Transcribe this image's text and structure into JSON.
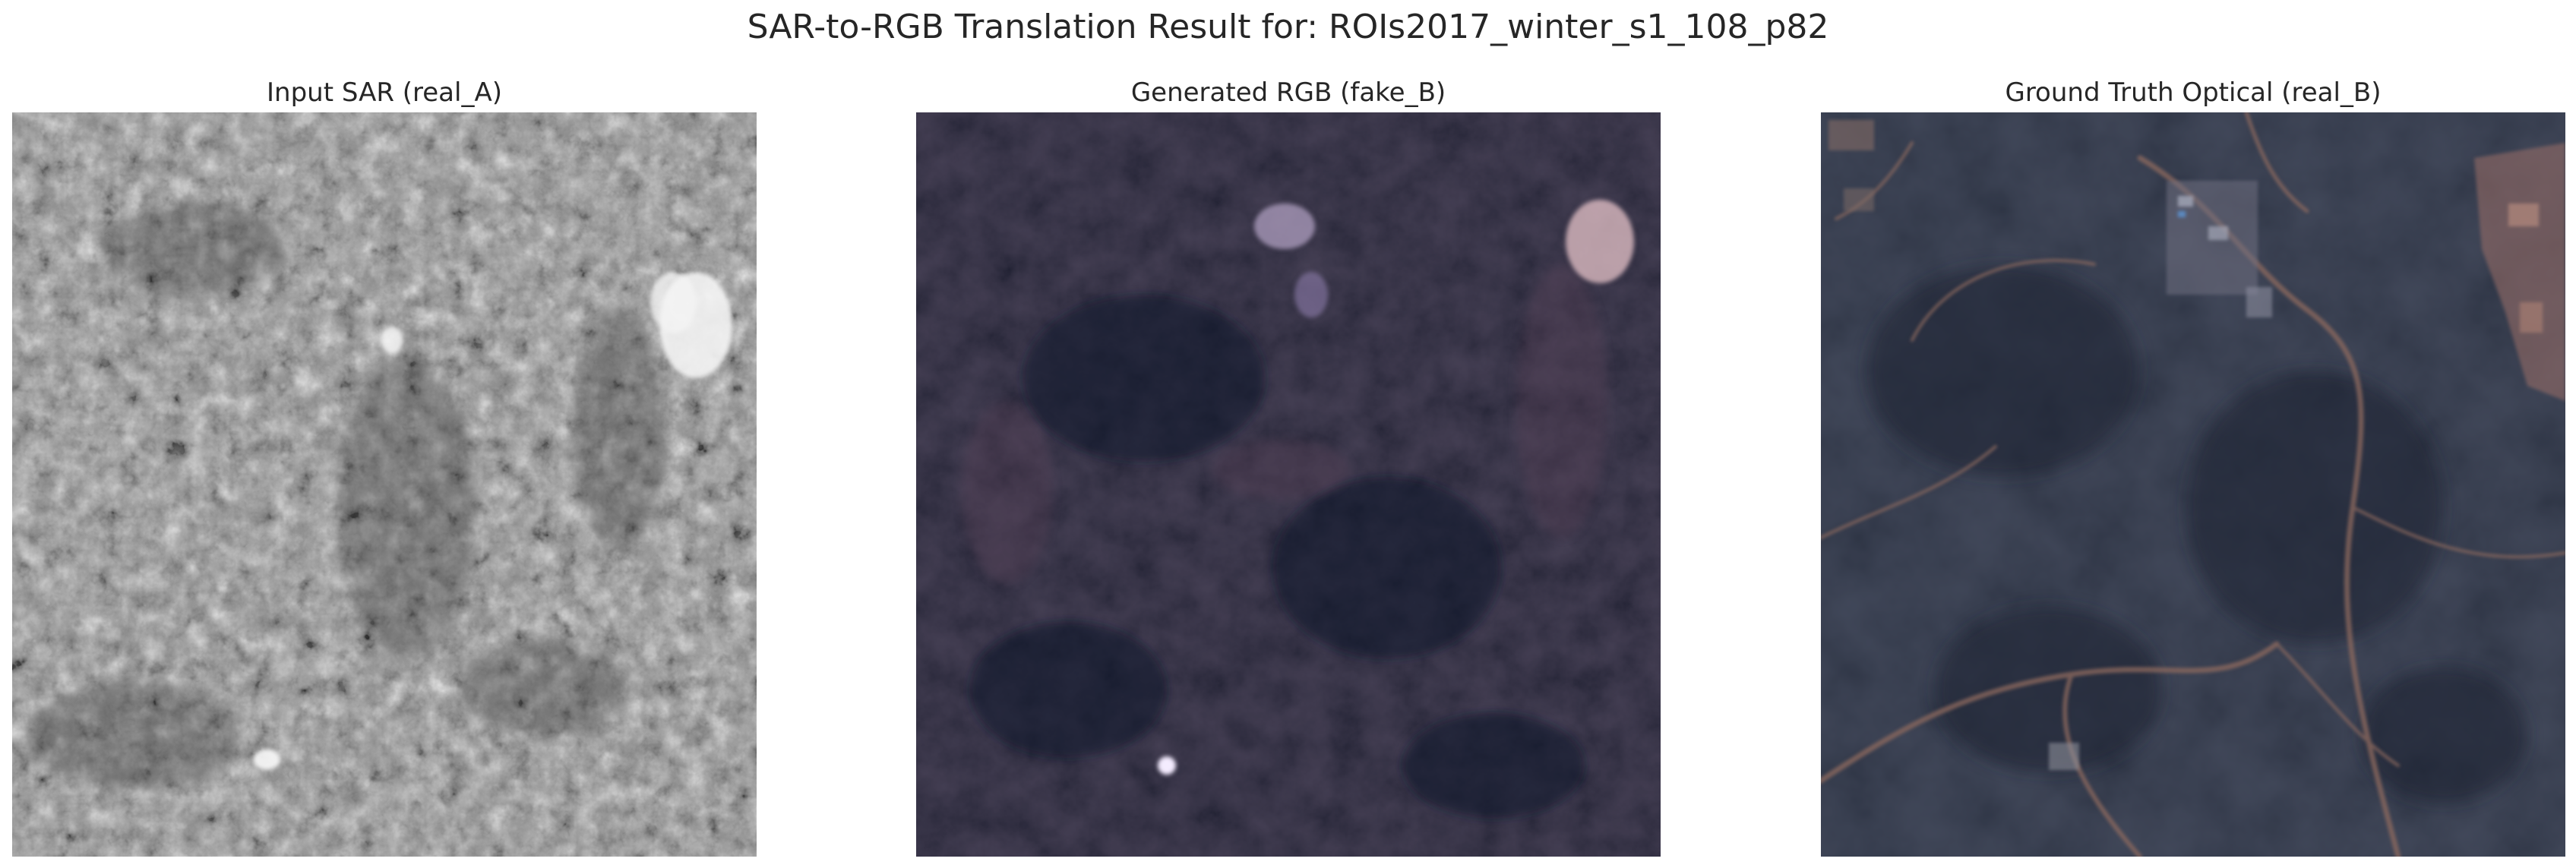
{
  "figure": {
    "title": "SAR-to-RGB Translation Result for: ROIs2017_winter_s1_108_p82"
  },
  "panels": [
    {
      "title": "Input SAR (real_A)",
      "image_kind": "grayscale speckled SAR backscatter image",
      "colors": {
        "base": "#8e8e8e",
        "dark": "#4a4a4a",
        "bright": "#f2f2f2"
      }
    },
    {
      "title": "Generated RGB (fake_B)",
      "image_kind": "dark navy synthesized optical image",
      "colors": {
        "base": "#1f2338",
        "dark": "#12152a",
        "bright": "#d9c8e8"
      }
    },
    {
      "title": "Ground Truth Optical (real_B)",
      "image_kind": "dark blue-grey satellite optical image with brown roads",
      "colors": {
        "base": "#2c3446",
        "dark": "#1e2434",
        "bright": "#b98a7a"
      }
    }
  ]
}
